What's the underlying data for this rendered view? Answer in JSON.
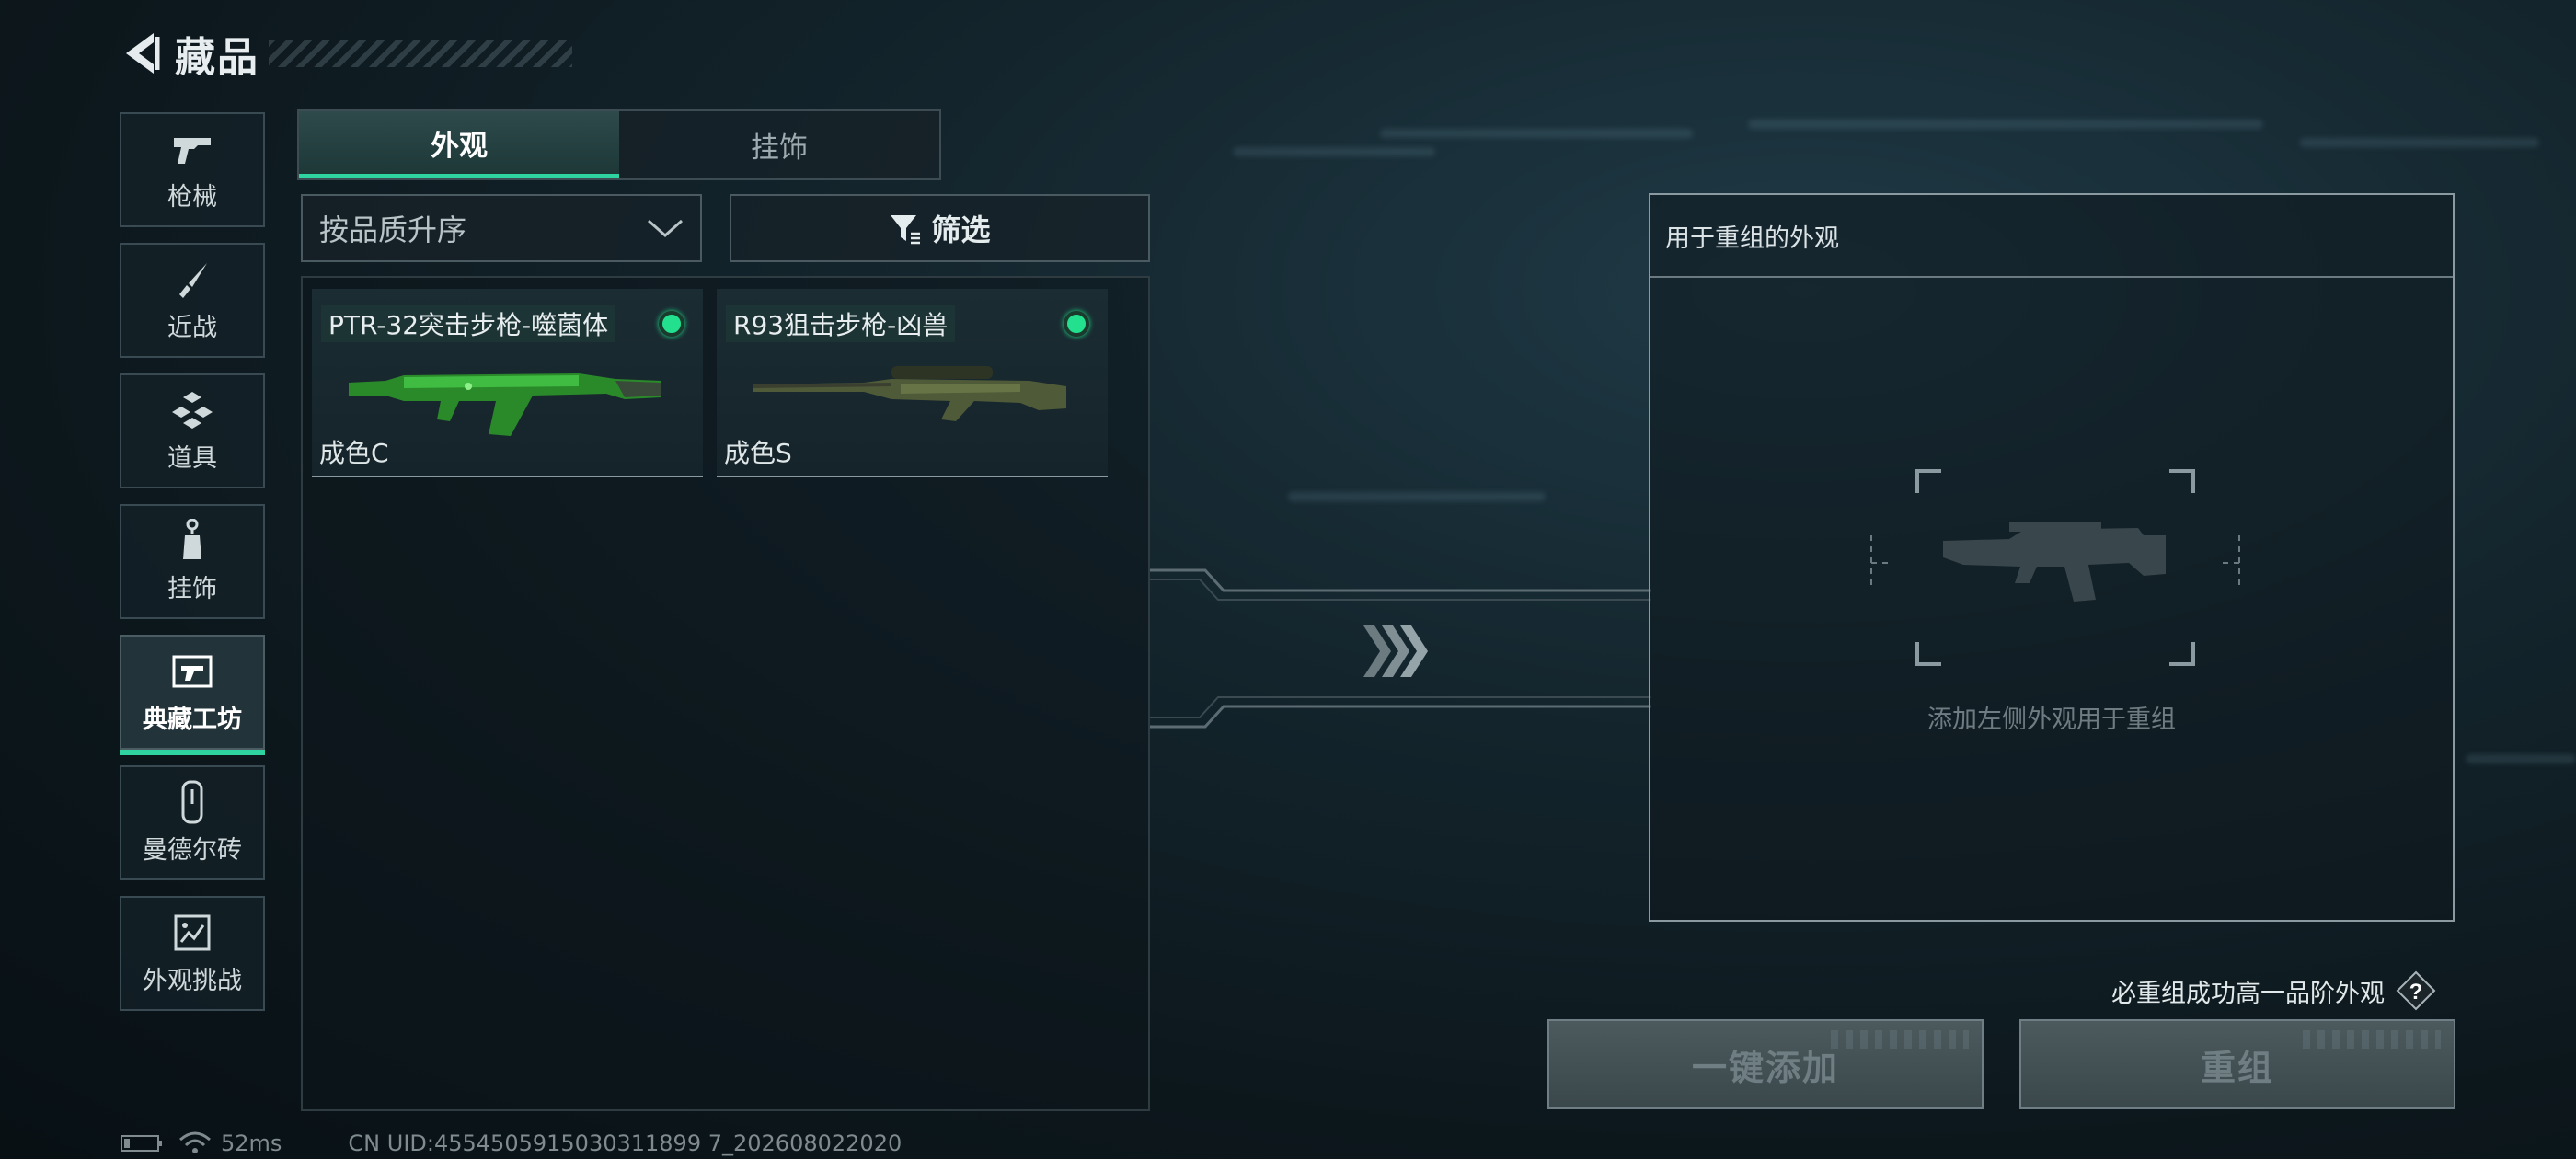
{
  "header": {
    "title": "藏品"
  },
  "categories": [
    {
      "label": "枪械"
    },
    {
      "label": "近战"
    },
    {
      "label": "道具"
    },
    {
      "label": "挂饰"
    },
    {
      "label": "典藏工坊",
      "active": true
    },
    {
      "label": "曼德尔砖"
    },
    {
      "label": "外观挑战"
    }
  ],
  "tabs": [
    {
      "label": "外观",
      "active": true
    },
    {
      "label": "挂饰"
    }
  ],
  "sort": {
    "value": "按品质升序"
  },
  "filter": {
    "label": "筛选"
  },
  "items": [
    {
      "name": "PTR-32突击步枪-噬菌体",
      "quality": "成色C",
      "icon": "assault-rifle-green"
    },
    {
      "name": "R93狙击步枪-凶兽",
      "quality": "成色S",
      "icon": "sniper-rifle-camo"
    }
  ],
  "recomp": {
    "title": "用于重组的外观",
    "hint": "添加左侧外观用于重组"
  },
  "guarantee": {
    "text": "必重组成功高一品阶外观"
  },
  "buttons": {
    "add_all": "一键添加",
    "recompose": "重组"
  },
  "status": {
    "ping": "52ms",
    "uid": "CN UID:4554505915030311899 7_202608022020"
  },
  "colors": {
    "accent": "#2fd3a0",
    "status_green": "#22e08e"
  }
}
